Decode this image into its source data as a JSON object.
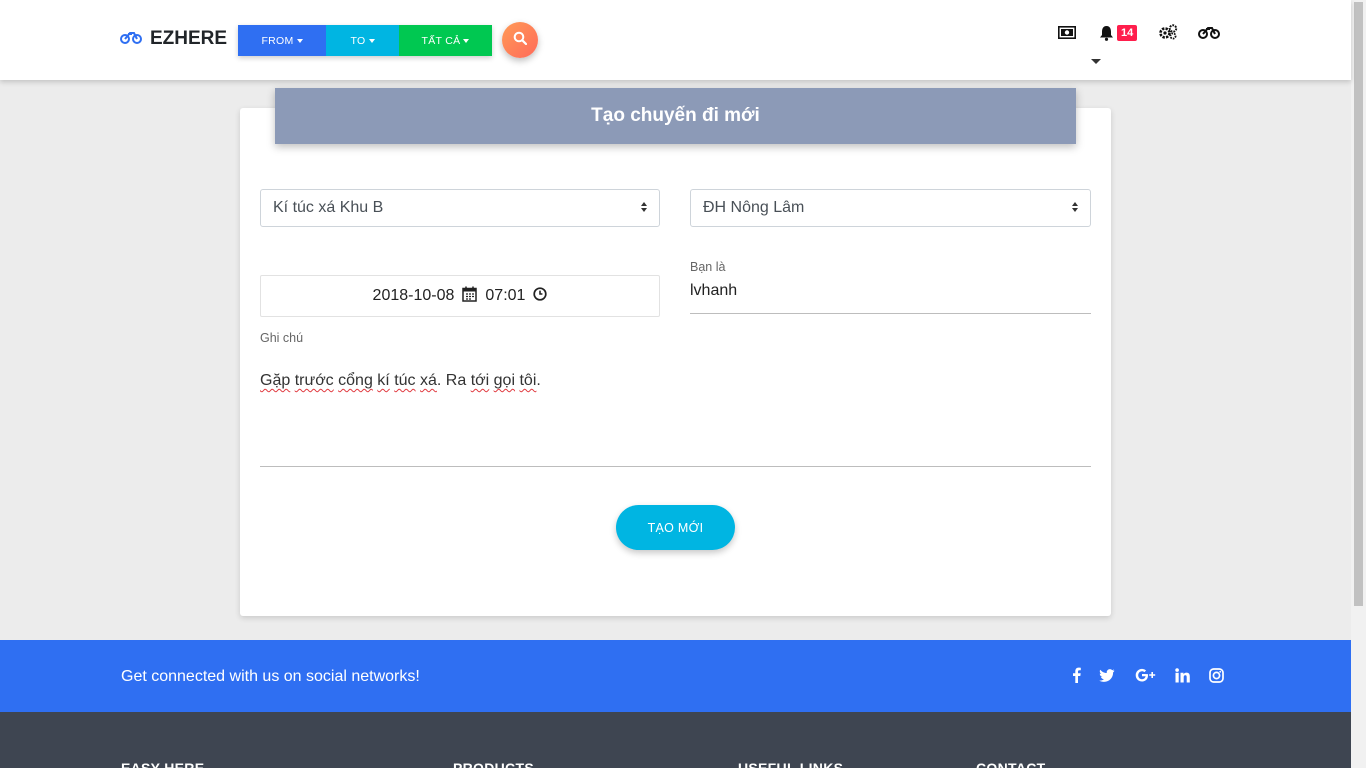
{
  "navbar": {
    "brand": "EZHERE",
    "brand_icon": "motorcycle-icon",
    "dropdowns": [
      {
        "label": "FROM",
        "color": "#2f6ff2"
      },
      {
        "label": "TO",
        "color": "#00b5e2"
      },
      {
        "label": "TẤT CẢ",
        "color": "#00c851"
      }
    ],
    "search_icon": "search-icon",
    "icons": [
      "money-icon",
      "bell-icon",
      "gears-icon",
      "motorcycle-icon"
    ],
    "notification_count": "14"
  },
  "form": {
    "title": "Tạo chuyến đi mới",
    "from_select": "Kí túc xá Khu B",
    "to_select": "ĐH Nông Lâm",
    "date": "2018-10-08",
    "time": "07:01",
    "user_label": "Bạn là",
    "user_value": "lvhanh",
    "note_label": "Ghi chú",
    "note_parts": [
      "Gặp",
      " ",
      "trước",
      " ",
      "cổng",
      " ",
      "kí",
      " ",
      "túc",
      " ",
      "xá",
      ". Ra ",
      "tới",
      " ",
      "gọi",
      " ",
      "tôi",
      "."
    ],
    "submit_label": "TẠO MỚI"
  },
  "footer": {
    "social_text": "Get connected with us on social networks!",
    "social_icons": [
      "facebook-icon",
      "twitter-icon",
      "google-plus-icon",
      "linkedin-icon",
      "instagram-icon"
    ],
    "columns": [
      "EASY HERE",
      "PRODUCTS",
      "USEFUL LINKS",
      "CONTACT"
    ]
  },
  "colors": {
    "primary": "#2f6ff2",
    "info": "#00b5e2",
    "success": "#00c851",
    "header": "#8c9ab7",
    "badge": "#ff1e4c",
    "footer_dark": "#3e4551"
  }
}
